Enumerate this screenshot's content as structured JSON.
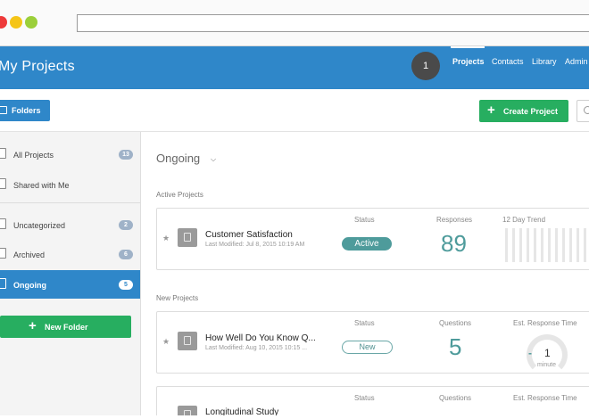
{
  "chrome": {
    "dots": [
      "#ee3a3a",
      "#f5c518",
      "#9bcf3a"
    ]
  },
  "header": {
    "title": "My Projects",
    "notification_count": "1",
    "nav": [
      "Projects",
      "Contacts",
      "Library",
      "Admin"
    ]
  },
  "toolbar": {
    "folders_label": "Folders",
    "create_label": "Create Project"
  },
  "sidebar": {
    "items": [
      {
        "label": "All Projects",
        "count": "13"
      },
      {
        "label": "Shared with Me",
        "count": ""
      },
      {
        "label": "Uncategorized",
        "count": "2"
      },
      {
        "label": "Archived",
        "count": "6"
      },
      {
        "label": "Ongoing",
        "count": "5"
      }
    ],
    "new_folder_label": "New Folder"
  },
  "main": {
    "folder_title": "Ongoing",
    "active_section": "Active Projects",
    "new_section": "New Projects",
    "projects": [
      {
        "name": "Customer Satisfaction",
        "modified": "Last Modified: Jul 8, 2015 10:19 AM",
        "status_header": "Status",
        "status": "Active",
        "metric_header": "Responses",
        "metric": "89",
        "extra_header": "12 Day Trend"
      },
      {
        "name": "How Well Do You Know Q...",
        "modified": "Last Modified: Aug 10, 2015 10:15 ...",
        "status_header": "Status",
        "status": "New",
        "metric_header": "Questions",
        "metric": "5",
        "extra_header": "Est. Response Time",
        "extra_value": "1",
        "extra_unit": "minute"
      },
      {
        "name": "Longitudinal Study",
        "status_header": "Status",
        "metric_header": "Questions",
        "extra_header": "Est. Response Time"
      }
    ]
  },
  "colors": {
    "brand_blue": "#2f87c9",
    "create_green": "#27ae60",
    "accent_teal": "#4e9b9b"
  }
}
